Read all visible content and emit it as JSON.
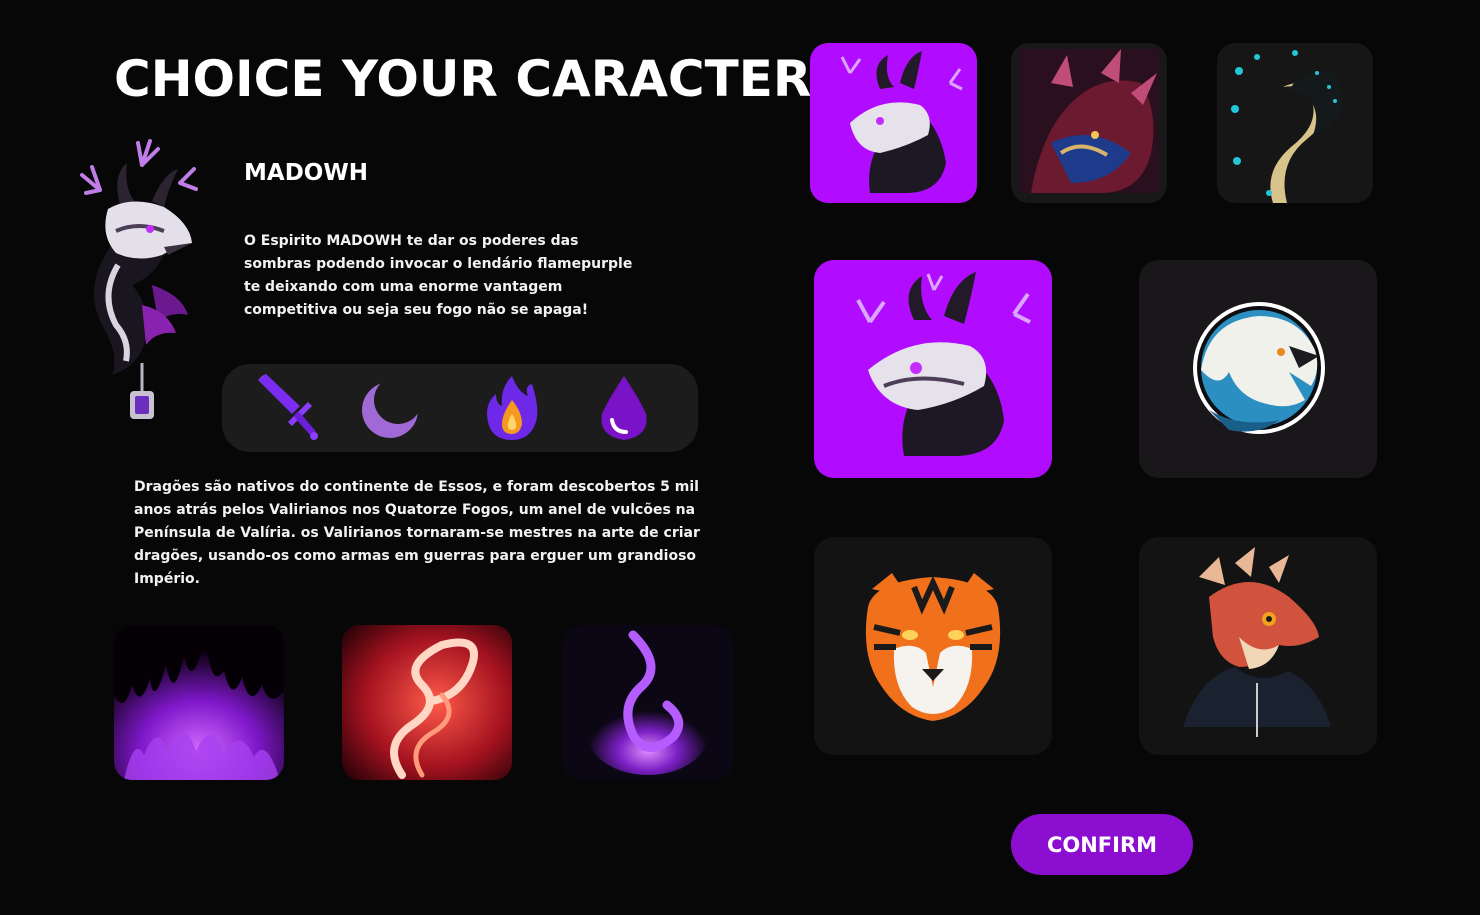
{
  "header": {
    "title": "CHOICE YOUR CARACTER"
  },
  "character": {
    "name": "MADOWH",
    "description": "O Espirito MADOWH te dar os poderes das sombras podendo invocar o lendário flamepurple te deixando com uma enorme vantagem competitiva ou seja seu fogo não se apaga!",
    "lore": "Dragões são nativos do continente de Essos, e foram descobertos 5 mil anos atrás pelos Valirianos nos Quatorze Fogos, um anel de vulcões na Península de Valíria. os Valirianos tornaram-se mestres na arte de criar dragões, usando-os como armas em guerras para erguer um grandioso Império."
  },
  "abilities": [
    {
      "icon": "sword-icon",
      "color": "#7a2cf0"
    },
    {
      "icon": "crescent-moon-icon",
      "color": "#a069d6"
    },
    {
      "icon": "flame-icon",
      "color": "#8a2be2"
    },
    {
      "icon": "water-drop-icon",
      "color": "#7a12c8"
    }
  ],
  "skill_images": [
    "purple-fire",
    "red-flame-swirl",
    "violet-flame"
  ],
  "colors": {
    "accent": "#8c0fd1",
    "selected_bg": "#b10cff",
    "panel": "#1c1c1c",
    "background": "#070707"
  },
  "actions": {
    "confirm_label": "CONFIRM"
  }
}
